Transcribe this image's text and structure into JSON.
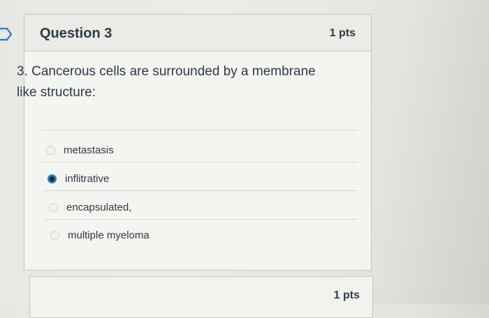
{
  "question": {
    "title": "Question 3",
    "points": "1 pts",
    "text": "3. Cancerous cells are surrounded by a membrane like structure:",
    "options": [
      {
        "label": "metastasis",
        "selected": false
      },
      {
        "label": "inflitrative",
        "selected": true
      },
      {
        "label": "encapsulated,",
        "selected": false
      },
      {
        "label": "multiple myeloma",
        "selected": false
      }
    ]
  },
  "next_question": {
    "points": "1 pts"
  },
  "colors": {
    "accent": "#2b7abc",
    "text": "#2d3b45"
  },
  "icons": {
    "flag": "flag-outline-icon"
  }
}
